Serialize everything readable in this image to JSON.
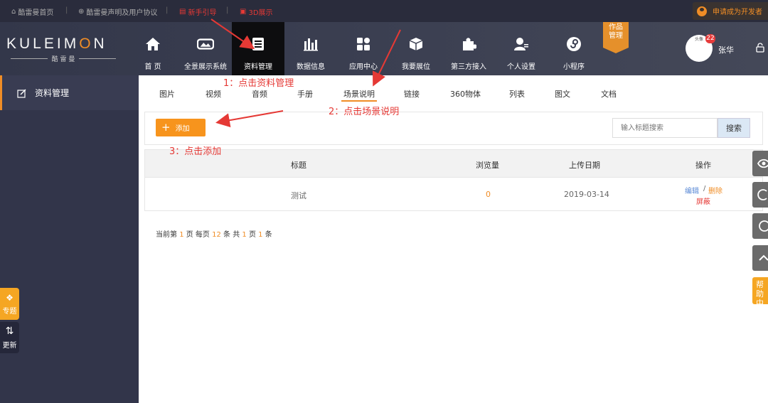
{
  "topbar": {
    "links": [
      {
        "label": "酷雷曼首页",
        "icon": "home-icon"
      },
      {
        "label": "酷雷曼声明及用户协议",
        "icon": "globe-icon"
      },
      {
        "label": "新手引导",
        "icon": "guide-icon"
      },
      {
        "label": "3D展示",
        "icon": "cube-icon"
      }
    ],
    "separator": "|",
    "developer_button": "申请成为开发者",
    "accent_color": "#e53935"
  },
  "logo": {
    "main_1": "KULEIM",
    "main_accent": "O",
    "main_2": "N",
    "sub": "酷 雷 曼"
  },
  "nav": {
    "items": [
      {
        "label": "首 页",
        "icon": "home-icon"
      },
      {
        "label": "全景展示系统",
        "icon": "panorama-icon"
      },
      {
        "label": "资料管理",
        "icon": "document-icon",
        "active": true
      },
      {
        "label": "数据信息",
        "icon": "bar-chart-icon"
      },
      {
        "label": "应用中心",
        "icon": "apps-icon"
      },
      {
        "label": "我要展位",
        "icon": "box-icon"
      },
      {
        "label": "第三方接入",
        "icon": "puzzle-icon"
      },
      {
        "label": "个人设置",
        "icon": "user-settings-icon"
      },
      {
        "label": "小程序",
        "icon": "mini-program-icon"
      }
    ],
    "works_badge_1": "作品",
    "works_badge_2": "管理"
  },
  "user": {
    "avatar_text": "头像",
    "badge": "22",
    "name": "张华"
  },
  "sidebar": {
    "item_label": "资料管理",
    "float_buttons": [
      {
        "label": "专题",
        "icon": "tag-icon"
      },
      {
        "label": "更新",
        "icon": "refresh-icon"
      }
    ]
  },
  "subtabs": [
    "图片",
    "视频",
    "音频",
    "手册",
    "场景说明",
    "链接",
    "360物体",
    "列表",
    "图文",
    "文档"
  ],
  "subtabs_active": "场景说明",
  "toolbar": {
    "add_icon": "+",
    "add_label": "添加",
    "search_placeholder": "输入标题搜索",
    "search_button": "搜索"
  },
  "table": {
    "headers": [
      "标题",
      "浏览量",
      "上传日期",
      "操作"
    ],
    "rows": [
      {
        "title": "测试",
        "views": "0",
        "date": "2019-03-14",
        "edit": "编辑",
        "slash": "/",
        "delete": "删除",
        "hide": "屏蔽"
      }
    ]
  },
  "pagination": {
    "p1": "当前第",
    "current": "1",
    "p2": "页 每页",
    "per_page": "12",
    "p3": "条 共",
    "total_pages": "1",
    "p4": "页",
    "total": "1",
    "p5": "条"
  },
  "annotations": {
    "step1": "1：点击资料管理",
    "step2": "2：点击场景说明",
    "step3": "3：点击添加"
  },
  "right_rail": {
    "help_label": "帮助中心"
  }
}
